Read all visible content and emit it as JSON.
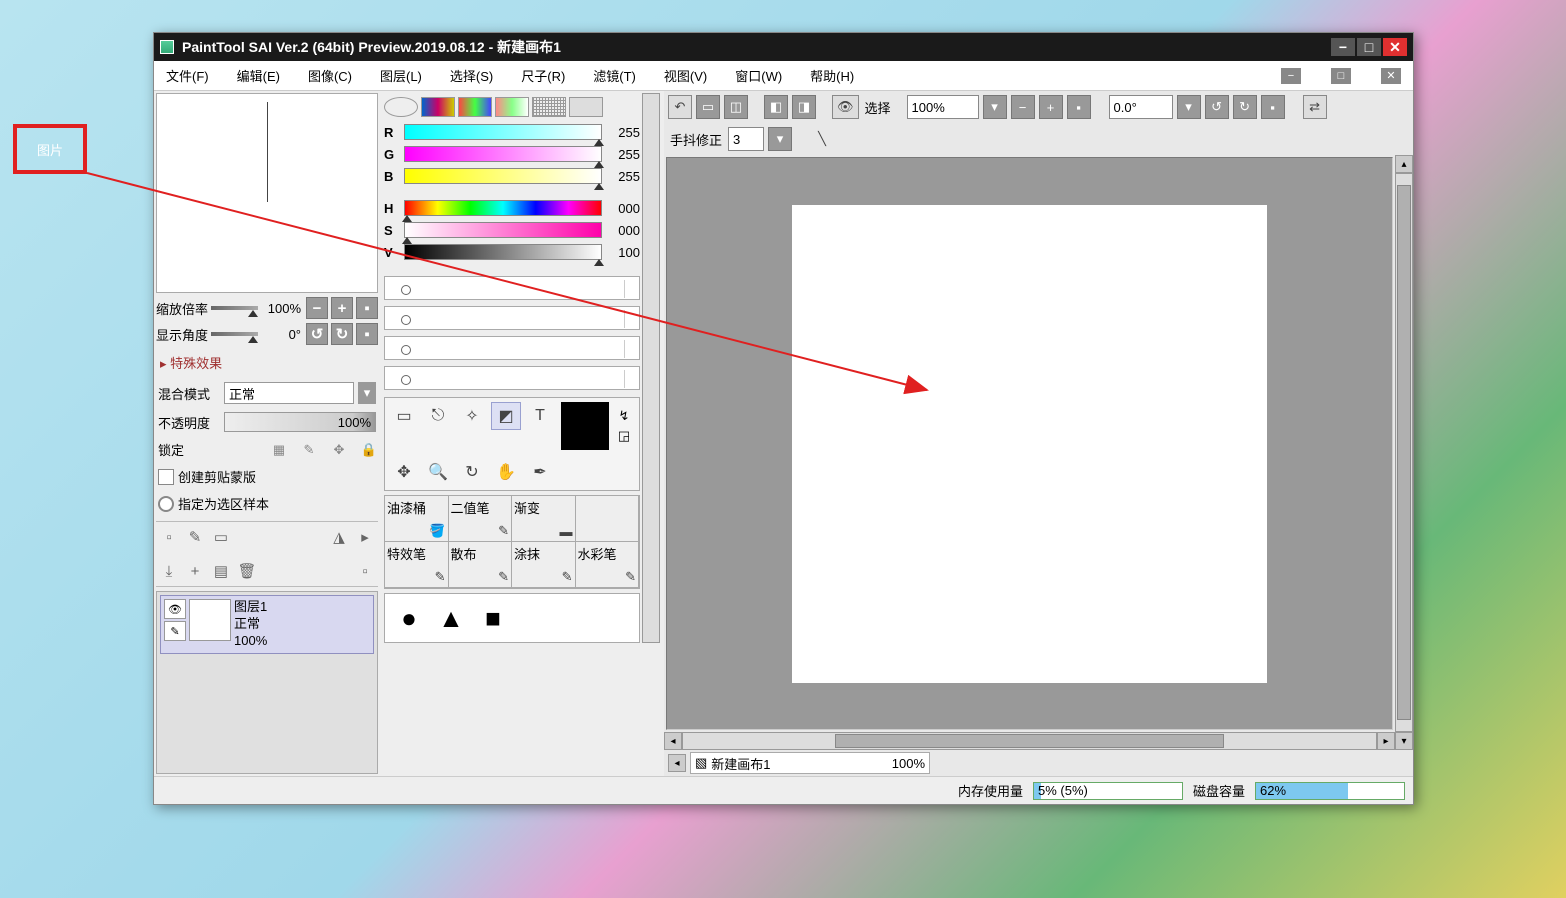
{
  "title": "PaintTool SAI Ver.2 (64bit) Preview.2019.08.12 - 新建画布1",
  "menu": [
    "文件(F)",
    "编辑(E)",
    "图像(C)",
    "图层(L)",
    "选择(S)",
    "尺子(R)",
    "滤镜(T)",
    "视图(V)",
    "窗口(W)",
    "帮助(H)"
  ],
  "nav": {
    "zoomLabel": "缩放倍率",
    "zoomVal": "100%",
    "angleLabel": "显示角度",
    "angleVal": "0°"
  },
  "fx": "特殊效果",
  "blend": {
    "label": "混合模式",
    "value": "正常"
  },
  "opacity": {
    "label": "不透明度",
    "value": "100%"
  },
  "lock": "锁定",
  "clip": "创建剪贴蒙版",
  "selsample": "指定为选区样本",
  "layer": {
    "name": "图层1",
    "mode": "正常",
    "opacity": "100%"
  },
  "rgb": {
    "R": "255",
    "G": "255",
    "B": "255"
  },
  "hsv": {
    "H": "000",
    "S": "000",
    "V": "100"
  },
  "brushes": [
    "油漆桶",
    "二值笔",
    "渐变",
    "",
    "特效笔",
    "散布",
    "涂抹",
    "水彩笔"
  ],
  "tb": {
    "selLabel": "选择",
    "zoom": "100%",
    "rot": "0.0°",
    "stab": "手抖修正",
    "stabVal": "3"
  },
  "tab": {
    "name": "新建画布1",
    "zoom": "100%"
  },
  "status": {
    "memLabel": "内存使用量",
    "memVal": "5% (5%)",
    "diskLabel": "磁盘容量",
    "diskVal": "62%"
  },
  "annotation": "图片"
}
